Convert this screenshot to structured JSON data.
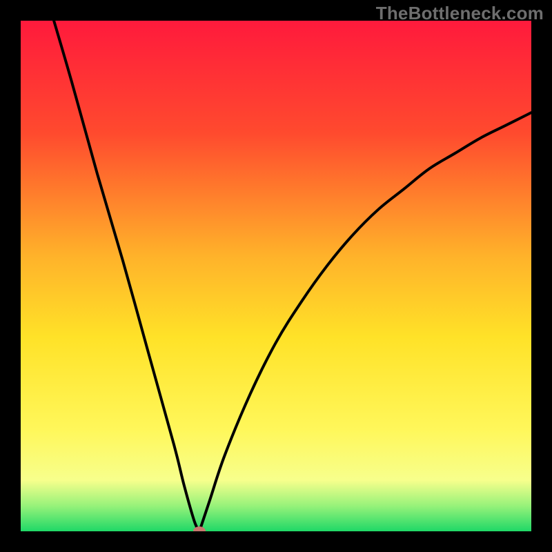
{
  "watermark": "TheBottleneck.com",
  "chart_data": {
    "type": "line",
    "title": "",
    "xlabel": "",
    "ylabel": "",
    "xlim": [
      0,
      100
    ],
    "ylim": [
      0,
      100
    ],
    "series": [
      {
        "name": "curve-left",
        "x": [
          6.5,
          10,
          15,
          20,
          25,
          30,
          32,
          34,
          35
        ],
        "values": [
          100,
          88,
          70,
          53,
          35,
          17,
          9,
          2,
          0
        ]
      },
      {
        "name": "curve-right",
        "x": [
          35,
          37,
          40,
          45,
          50,
          55,
          60,
          65,
          70,
          75,
          80,
          85,
          90,
          95,
          100
        ],
        "values": [
          0,
          6,
          15,
          27,
          37,
          45,
          52,
          58,
          63,
          67,
          71,
          74,
          77,
          79.5,
          82
        ]
      }
    ],
    "marker": {
      "x": 35,
      "y": 0,
      "color": "#c8786e"
    },
    "gradient_stops": [
      {
        "pct": 0,
        "color": "#ff1a3c"
      },
      {
        "pct": 22,
        "color": "#ff4a2e"
      },
      {
        "pct": 46,
        "color": "#ffb22a"
      },
      {
        "pct": 62,
        "color": "#ffe228"
      },
      {
        "pct": 80,
        "color": "#fff75a"
      },
      {
        "pct": 90,
        "color": "#f7ff8c"
      },
      {
        "pct": 95,
        "color": "#97f27a"
      },
      {
        "pct": 100,
        "color": "#1fd867"
      }
    ]
  }
}
